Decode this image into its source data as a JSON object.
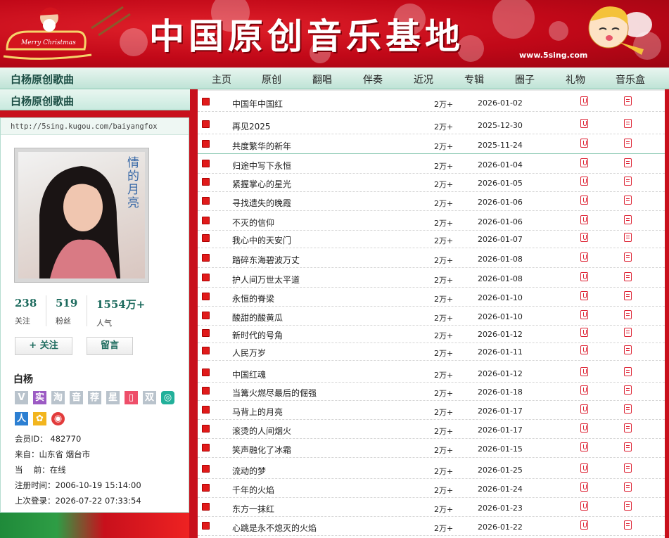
{
  "banner": {
    "title": "中国原创音乐基地",
    "site_url": "www.5sing.com",
    "sleigh_text": "Merry Christmas"
  },
  "nav": {
    "page_title": "白杨原创歌曲",
    "items": [
      "主页",
      "原创",
      "翻唱",
      "伴奏",
      "近况",
      "专辑",
      "圈子",
      "礼物",
      "音乐盒"
    ]
  },
  "sidebar": {
    "title": "白杨原创歌曲",
    "profile_url": "http://5sing.kugou.com/baiyangfox",
    "avatar_caption": "情的月亮",
    "stats": [
      {
        "value": "238",
        "label": "关注"
      },
      {
        "value": "519",
        "label": "粉丝"
      },
      {
        "value": "1554万+",
        "label": "人气"
      }
    ],
    "follow_button": "+ 关注",
    "message_button": "留言",
    "user_name": "白杨",
    "badges_row1": [
      "V",
      "实",
      "淘",
      "音",
      "荐",
      "星",
      "▯",
      "双",
      "◎"
    ],
    "badges_row2": [
      "人",
      "✿",
      "◉"
    ],
    "info": [
      "会员ID： 482770",
      "来自：山东省 烟台市",
      "当　 前：在线",
      "注册时间：2006-10-19 15:14:00",
      "上次登录：2026-07-22 07:33:54"
    ]
  },
  "songs": [
    {
      "name": "中国年中国红",
      "plays": "2万+",
      "date": "2026-01-02"
    },
    {
      "name": "再见2025",
      "plays": "2万+",
      "date": "2025-12-30"
    },
    {
      "name": "共度繁华的新年",
      "plays": "2万+",
      "date": "2025-11-24"
    },
    {
      "name": "归途中写下永恒",
      "plays": "2万+",
      "date": "2026-01-04"
    },
    {
      "name": "紧握掌心的星光",
      "plays": "2万+",
      "date": "2026-01-05"
    },
    {
      "name": "寻找遗失的晚霞",
      "plays": "2万+",
      "date": "2026-01-06"
    },
    {
      "name": "不灭的信仰",
      "plays": "2万+",
      "date": "2026-01-06"
    },
    {
      "name": "我心中的天安门",
      "plays": "2万+",
      "date": "2026-01-07"
    },
    {
      "name": "踏碎东海碧波万丈",
      "plays": "2万+",
      "date": "2026-01-08"
    },
    {
      "name": "护人间万世太平道",
      "plays": "2万+",
      "date": "2026-01-08"
    },
    {
      "name": "永恒的脊梁",
      "plays": "2万+",
      "date": "2026-01-10"
    },
    {
      "name": "酸甜的酸黄瓜",
      "plays": "2万+",
      "date": "2026-01-10"
    },
    {
      "name": "新时代的号角",
      "plays": "2万+",
      "date": "2026-01-12"
    },
    {
      "name": "人民万岁",
      "plays": "2万+",
      "date": "2026-01-11"
    },
    {
      "name": "中国红魂",
      "plays": "2万+",
      "date": "2026-01-12"
    },
    {
      "name": "当篝火燃尽最后的倔强",
      "plays": "2万+",
      "date": "2026-01-18"
    },
    {
      "name": "马背上的月亮",
      "plays": "2万+",
      "date": "2026-01-17"
    },
    {
      "name": "滚烫的人间烟火",
      "plays": "2万+",
      "date": "2026-01-17"
    },
    {
      "name": "笑声融化了冰霜",
      "plays": "2万+",
      "date": "2026-01-15"
    },
    {
      "name": "流动的梦",
      "plays": "2万+",
      "date": "2026-01-25"
    },
    {
      "name": "千年的火焰",
      "plays": "2万+",
      "date": "2026-01-24"
    },
    {
      "name": "东方一抹红",
      "plays": "2万+",
      "date": "2026-01-23"
    },
    {
      "name": "心跳是永不熄灭的火焰",
      "plays": "2万+",
      "date": "2026-01-22"
    }
  ],
  "colors": {
    "banner_red": "#c8101c",
    "nav_green": "#bfe3d6",
    "accent_teal": "#1d6b5e",
    "song_marker": "#e01a1a"
  }
}
